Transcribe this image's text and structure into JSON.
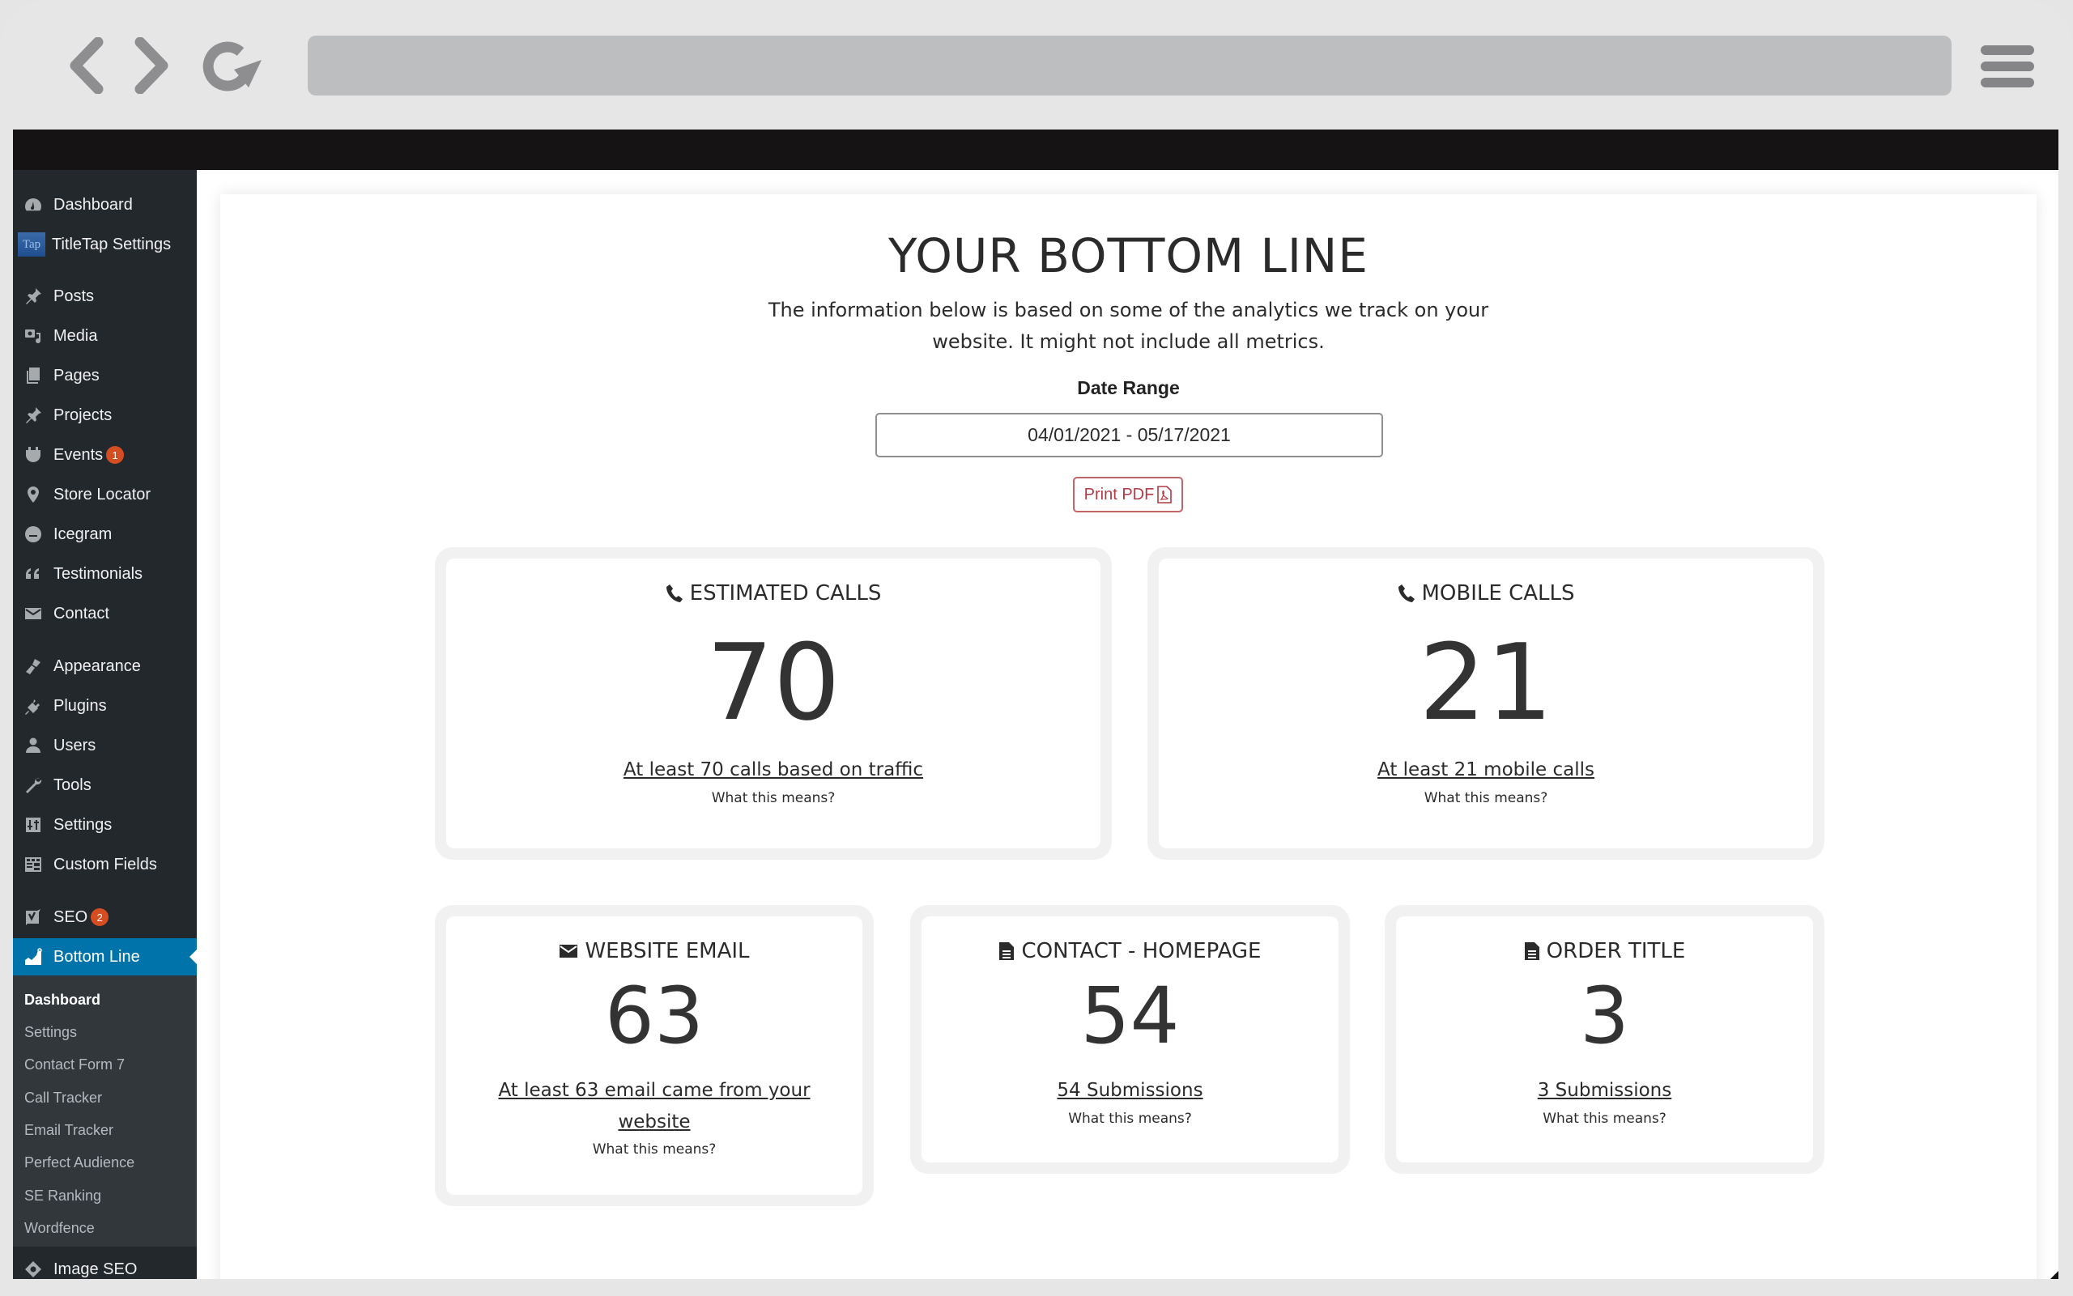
{
  "browser": {
    "back_icon": "chevron-left-icon",
    "forward_icon": "chevron-right-icon",
    "reload_icon": "reload-icon",
    "menu_icon": "hamburger-menu-icon",
    "address": ""
  },
  "sidebar": {
    "items": [
      {
        "label": "Dashboard",
        "icon": "dashboard-gauge-icon"
      },
      {
        "label": "TitleTap Settings",
        "icon": "titletap-logo",
        "logo_text": "Tap"
      },
      {
        "label": "Posts",
        "icon": "pushpin-icon"
      },
      {
        "label": "Media",
        "icon": "media-icon"
      },
      {
        "label": "Pages",
        "icon": "pages-icon"
      },
      {
        "label": "Projects",
        "icon": "pushpin-icon"
      },
      {
        "label": "Events",
        "icon": "calendar-icon",
        "badge": "1"
      },
      {
        "label": "Store Locator",
        "icon": "location-pin-icon"
      },
      {
        "label": "Icegram",
        "icon": "icegram-icon"
      },
      {
        "label": "Testimonials",
        "icon": "quote-icon"
      },
      {
        "label": "Contact",
        "icon": "envelope-icon"
      },
      {
        "label": "Appearance",
        "icon": "paintbrush-icon"
      },
      {
        "label": "Plugins",
        "icon": "plug-icon"
      },
      {
        "label": "Users",
        "icon": "user-icon"
      },
      {
        "label": "Tools",
        "icon": "wrench-icon"
      },
      {
        "label": "Settings",
        "icon": "sliders-icon"
      },
      {
        "label": "Custom Fields",
        "icon": "table-icon"
      },
      {
        "label": "SEO",
        "icon": "yoast-icon",
        "badge": "2"
      },
      {
        "label": "Bottom Line",
        "icon": "chart-line-icon",
        "active": true
      },
      {
        "label": "Image SEO",
        "icon": "image-seo-icon"
      }
    ],
    "submenu": [
      {
        "label": "Dashboard",
        "current": true
      },
      {
        "label": "Settings"
      },
      {
        "label": "Contact Form 7"
      },
      {
        "label": "Call Tracker"
      },
      {
        "label": "Email Tracker"
      },
      {
        "label": "Perfect Audience"
      },
      {
        "label": "SE Ranking"
      },
      {
        "label": "Wordfence"
      }
    ]
  },
  "main": {
    "title": "YOUR BOTTOM LINE",
    "intro": "The information below is based on some of the analytics we track on your website. It might not include all metrics.",
    "date_range": {
      "label": "Date Range",
      "value": "04/01/2021 - 05/17/2021"
    },
    "print_button": {
      "label": "Print PDF",
      "icon": "pdf-file-icon"
    },
    "accent_color": "#b03a45",
    "cards": [
      {
        "title": "ESTIMATED CALLS",
        "icon": "phone-icon",
        "value": "70",
        "link": "At least 70 calls based on traffic",
        "help": "What this means?"
      },
      {
        "title": "MOBILE CALLS",
        "icon": "phone-icon",
        "value": "21",
        "link": "At least 21 mobile calls",
        "help": "What this means?"
      },
      {
        "title": "WEBSITE EMAIL",
        "icon": "envelope-icon",
        "value": "63",
        "link": "At least 63 email came from your website",
        "help": "What this means?"
      },
      {
        "title": "CONTACT - HOMEPAGE",
        "icon": "document-icon",
        "value": "54",
        "link": "54 Submissions",
        "help": "What this means?"
      },
      {
        "title": "ORDER TITLE",
        "icon": "document-icon",
        "value": "3",
        "link": "3 Submissions",
        "help": "What this means?"
      }
    ]
  }
}
